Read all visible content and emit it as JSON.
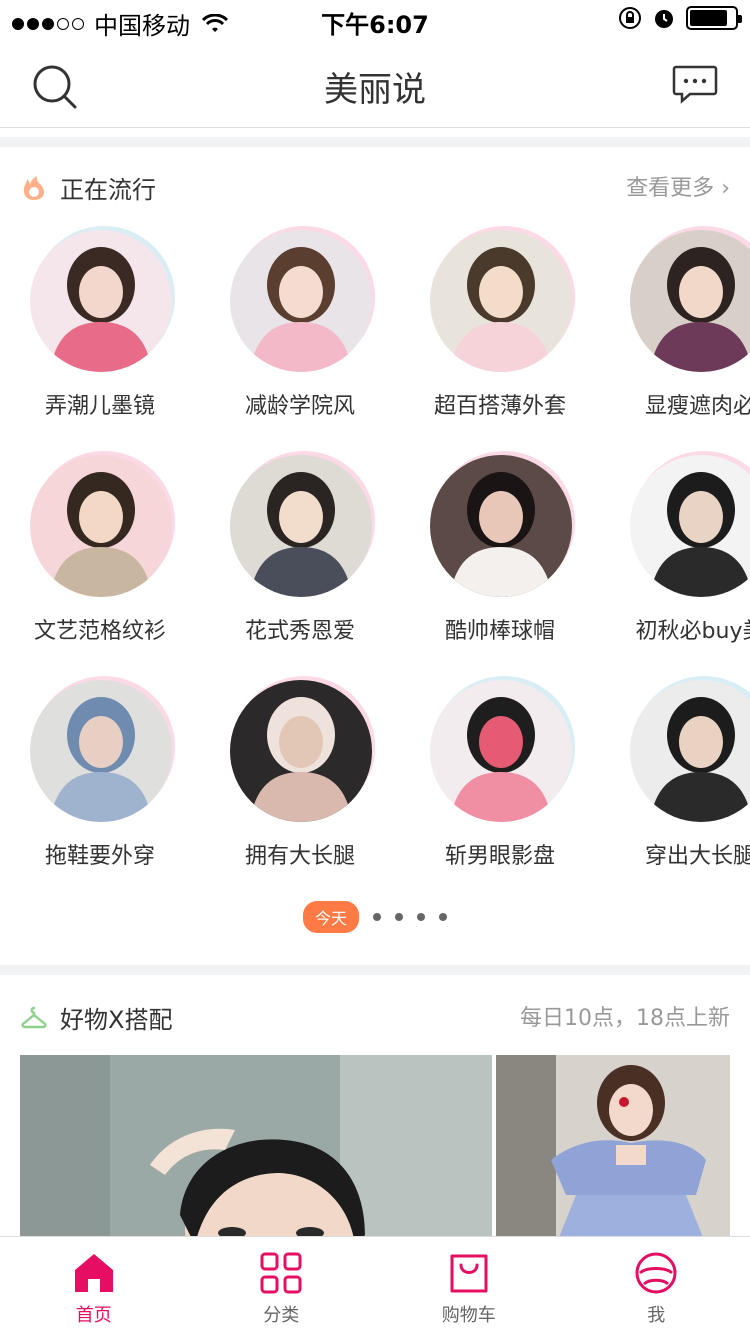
{
  "status_bar": {
    "carrier": "中国移动",
    "time": "下午6:07",
    "signal_bars": 3,
    "battery_level": 0.85
  },
  "nav": {
    "title": "美丽说",
    "search_icon": "search-icon",
    "message_icon": "message-icon"
  },
  "trending": {
    "title": "正在流行",
    "more": "查看更多",
    "items": [
      {
        "label": "弄潮儿墨镜"
      },
      {
        "label": "减龄学院风"
      },
      {
        "label": "超百搭薄外套"
      },
      {
        "label": "显瘦遮肉必"
      },
      {
        "label": "文艺范格纹衫"
      },
      {
        "label": "花式秀恩爱"
      },
      {
        "label": "酷帅棒球帽"
      },
      {
        "label": "初秋必buy美"
      },
      {
        "label": "拖鞋要外穿"
      },
      {
        "label": "拥有大长腿"
      },
      {
        "label": "斩男眼影盘"
      },
      {
        "label": "穿出大长腿"
      }
    ],
    "pager_label": "今天",
    "pager_dots": 4
  },
  "outfit": {
    "title": "好物X搭配",
    "schedule": "每日10点，18点上新"
  },
  "tabbar": {
    "items": [
      {
        "label": "首页",
        "icon": "home-icon",
        "active": true
      },
      {
        "label": "分类",
        "icon": "category-grid-icon",
        "active": false
      },
      {
        "label": "购物车",
        "icon": "shopping-bag-icon",
        "active": false
      },
      {
        "label": "我",
        "icon": "profile-icon",
        "active": false
      }
    ]
  },
  "colors": {
    "accent": "#e60e63",
    "pager_accent": "#ff7a45",
    "gap": "#f1f2f4"
  }
}
